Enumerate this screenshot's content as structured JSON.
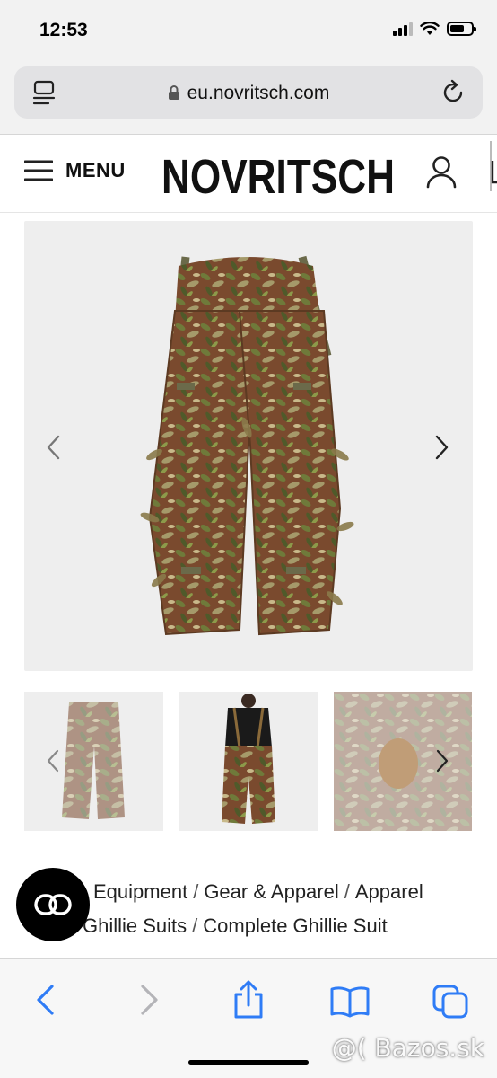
{
  "status_bar": {
    "time": "12:53",
    "signal_icon": "cellular-signal-icon",
    "wifi_icon": "wifi-icon",
    "battery_icon": "battery-icon",
    "battery_level": 0.7
  },
  "browser": {
    "url": "eu.novritsch.com",
    "reader_icon": "reader-mode-icon",
    "lock_icon": "lock-icon",
    "reload_icon": "reload-icon"
  },
  "site_header": {
    "menu_label": "MENU",
    "logo_text": "NOVRITSCH",
    "account_icon": "user-icon"
  },
  "gallery": {
    "main_image": "ghillie-pants-image",
    "prev_icon": "chevron-left-icon",
    "next_icon": "chevron-right-icon",
    "thumbnails": [
      "ghillie-pants-thumbnail",
      "model-wearing-pants-thumbnail",
      "ghillie-closeup-thumbnail"
    ]
  },
  "breadcrumb": {
    "items": [
      "Equipment",
      "Gear & Apparel",
      "Apparel",
      "Ghillie Suits",
      "Complete Ghillie Suit"
    ],
    "separator": "/"
  },
  "chat_icon": "chat-icon",
  "toolbar": {
    "back_icon": "back-icon",
    "forward_icon": "forward-icon",
    "share_icon": "share-icon",
    "bookmarks_icon": "bookmarks-icon",
    "tabs_icon": "tabs-icon"
  },
  "watermark": "@( Bazos.sk",
  "colors": {
    "accent": "#2f7cf6",
    "disabled": "#b4b4b8",
    "camo_brown": "#7a4a2e",
    "camo_green": "#6f7a3a"
  }
}
